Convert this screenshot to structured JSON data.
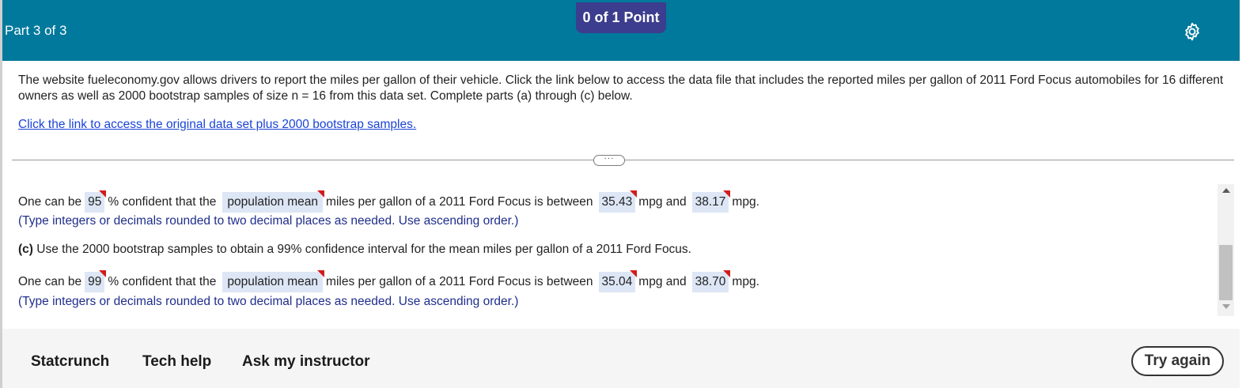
{
  "header": {
    "part_label": "Part 3 of 3",
    "points_label": "0 of 1 Point",
    "settings_icon": "gear-icon"
  },
  "intro": {
    "text": "The website fueleconomy.gov allows drivers to report the miles per gallon of their vehicle.  Click the link below to access the data file that includes the reported miles per gallon of 2011 Ford Focus automobiles for 16 different owners as well as 2000 bootstrap samples of size n =  16 from this data set. Complete parts (a) through (c) below.",
    "link_text": "Click the link to access the original data set plus 2000 bootstrap samples."
  },
  "expander_label": "···",
  "answer_b": {
    "prefix": "One can be",
    "confidence": "95",
    "mid1": "% confident that the",
    "parameter": "population mean",
    "mid2": "miles per gallon of a 2011 Ford Focus is between",
    "lower": "35.43",
    "mid3": "mpg and",
    "upper": "38.17",
    "suffix": "mpg.",
    "hint": "(Type integers or decimals rounded to two decimal places as needed. Use ascending order.)"
  },
  "part_c": {
    "label": "(c)",
    "text": "Use the 2000 bootstrap samples to obtain a 99% confidence interval for the mean miles per gallon of a 2011 Ford Focus."
  },
  "answer_c": {
    "prefix": "One can be",
    "confidence": "99",
    "mid1": "% confident that the",
    "parameter": "population mean",
    "mid2": "miles per gallon of a 2011 Ford Focus is between",
    "lower": "35.04",
    "mid3": "mpg and",
    "upper": "38.70",
    "suffix": "mpg.",
    "hint": "(Type integers or decimals rounded to two decimal places as needed. Use ascending order.)"
  },
  "footer": {
    "statcrunch": "Statcrunch",
    "tech_help": "Tech help",
    "ask_instructor": "Ask my instructor",
    "try_again": "Try again"
  },
  "colors": {
    "header_bg": "#00799c",
    "points_bg": "#3c3d8e",
    "link": "#1a44d6",
    "hint": "#1f2e8c",
    "answer_box": "#dde6f5",
    "incorrect_flag": "#d21c1c"
  }
}
